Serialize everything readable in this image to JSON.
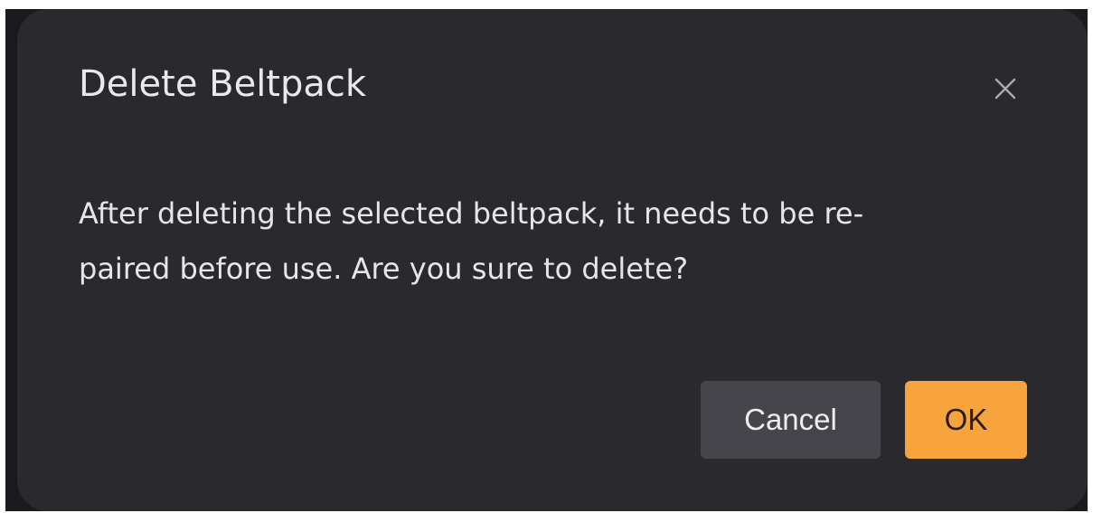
{
  "dialog": {
    "title": "Delete Beltpack",
    "message_line1": "After deleting the selected beltpack, it needs to be re-",
    "message_line2": "paired before use. Are you sure to delete?",
    "close_icon": "close-icon",
    "cancel_label": "Cancel",
    "ok_label": "OK"
  },
  "colors": {
    "dialog_background": "#2a292e",
    "cancel_button": "#46454c",
    "ok_button": "#f8a43d",
    "text": "#e9e9ea"
  }
}
